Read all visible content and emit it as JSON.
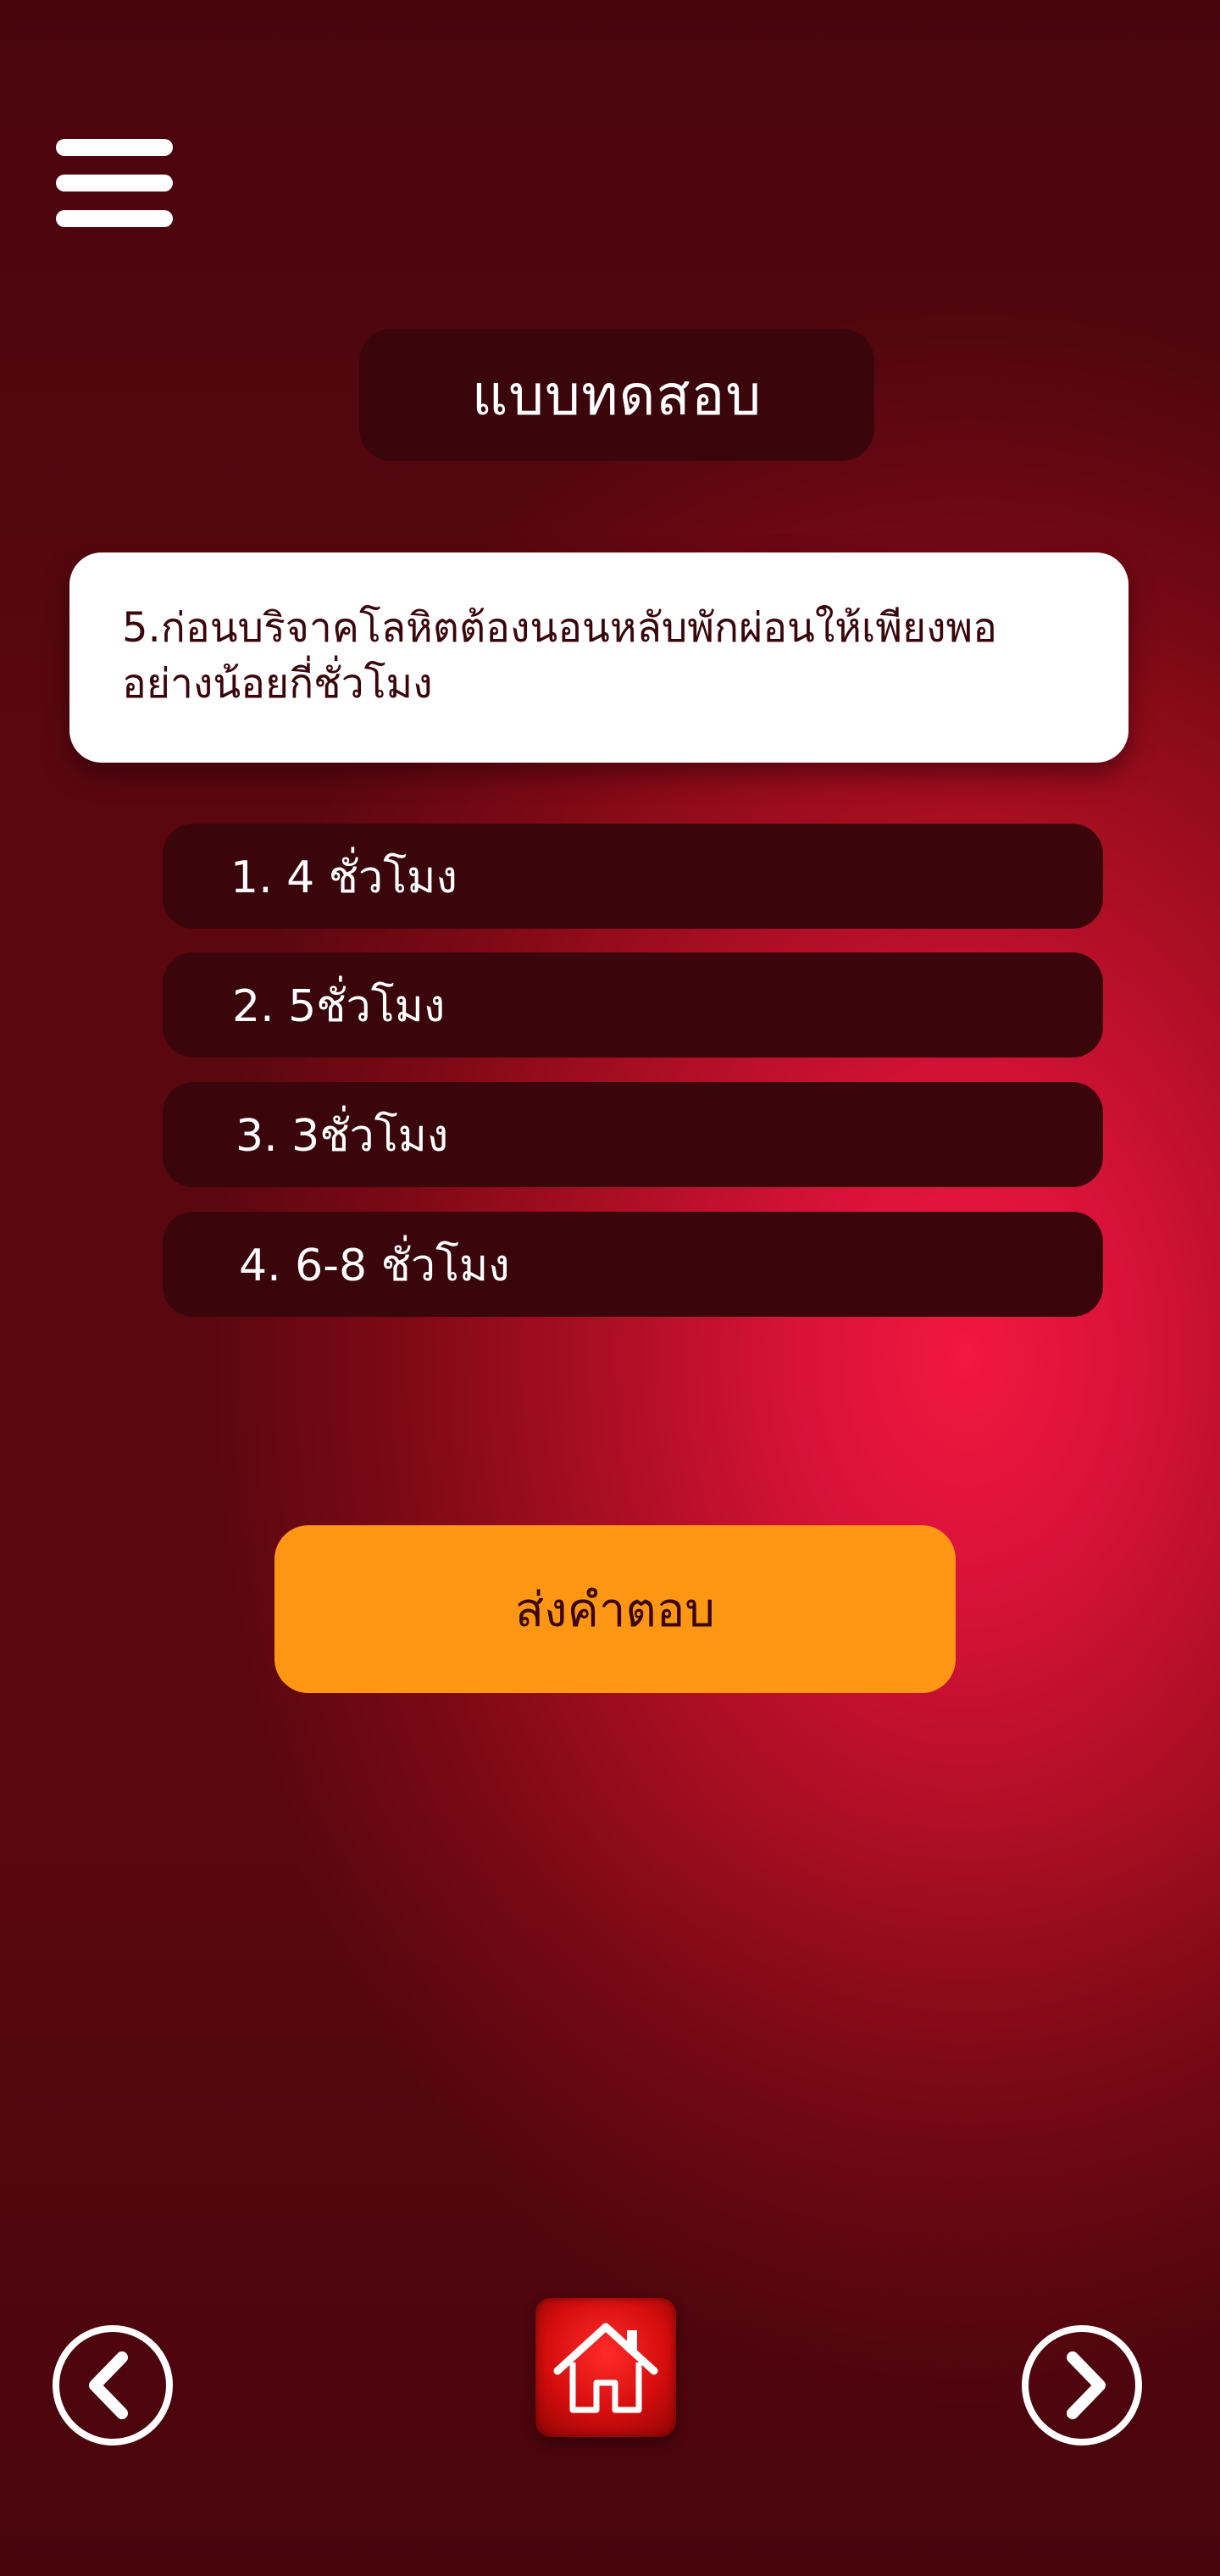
{
  "header": {
    "title": "แบบทดสอบ",
    "menu_icon": "hamburger-menu-icon"
  },
  "question": {
    "text_line1": "5.ก่อนบริจาคโลหิตต้องนอนหลับพักผ่อนให้เพียงพอ",
    "text_line2": "อย่างน้อยกี่ชั่วโมง"
  },
  "options": [
    {
      "label": "1. 4 ชั่วโมง"
    },
    {
      "label": "2. 5ชั่วโมง"
    },
    {
      "label": "3. 3ชั่วโมง"
    },
    {
      "label": "4. 6-8 ชั่วโมง"
    }
  ],
  "submit": {
    "label": "ส่งคำตอบ"
  },
  "footer": {
    "prev_icon": "chevron-left-icon",
    "home_icon": "home-icon",
    "next_icon": "chevron-right-icon"
  },
  "colors": {
    "accent": "#ff9714",
    "pill": "#3a060c",
    "background_center": "#f2173f",
    "background_edge": "#5a0710"
  }
}
